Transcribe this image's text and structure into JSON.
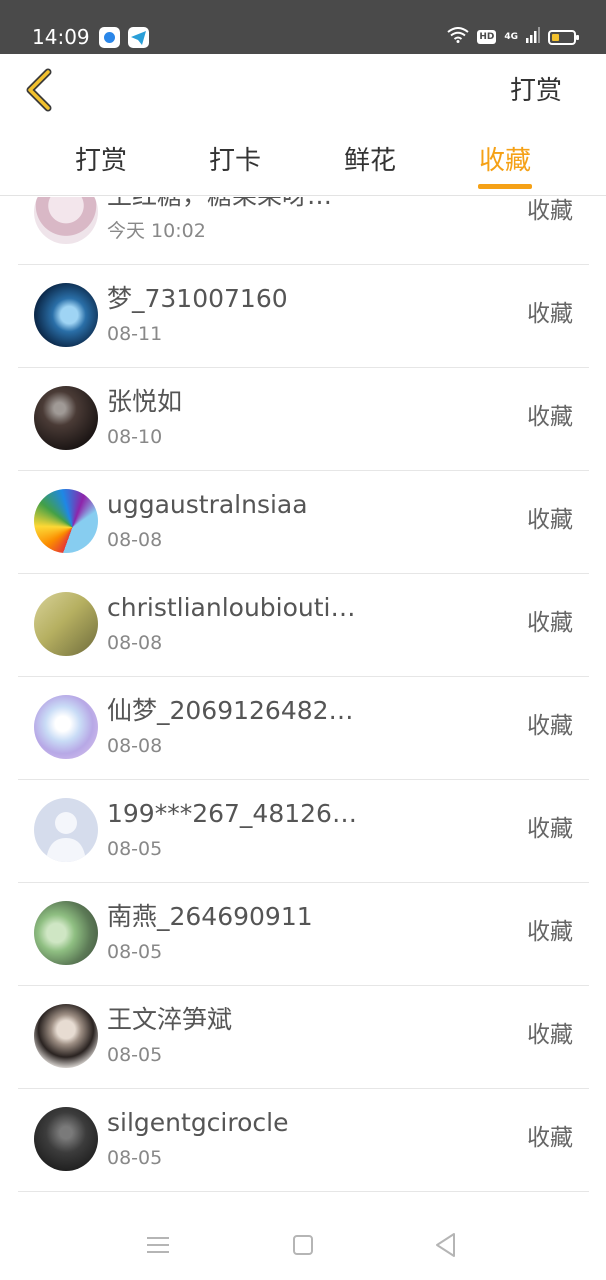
{
  "status_bar": {
    "time": "14:09",
    "hd_label": "HD",
    "network_label": "4G",
    "icons": [
      "app-icon-1",
      "app-icon-2",
      "wifi-icon",
      "signal-icon",
      "battery-icon"
    ]
  },
  "header": {
    "right_action": "打赏"
  },
  "tabs": [
    {
      "label": "打赏",
      "active": false
    },
    {
      "label": "打卡",
      "active": false
    },
    {
      "label": "鲜花",
      "active": false
    },
    {
      "label": "收藏",
      "active": true
    }
  ],
  "accent_color": "#f5a116",
  "list": [
    {
      "name": "王红糖，糖果果呀…",
      "date": "今天 10:02",
      "action": "收藏"
    },
    {
      "name": "梦_731007160",
      "date": "08-11",
      "action": "收藏"
    },
    {
      "name": "张悦如",
      "date": "08-10",
      "action": "收藏"
    },
    {
      "name": "uggaustralnsiaa",
      "date": "08-08",
      "action": "收藏"
    },
    {
      "name": "christlianloubiouti…",
      "date": "08-08",
      "action": "收藏"
    },
    {
      "name": "仙梦_2069126482…",
      "date": "08-08",
      "action": "收藏"
    },
    {
      "name": "199***267_48126…",
      "date": "08-05",
      "action": "收藏"
    },
    {
      "name": "南燕_264690911",
      "date": "08-05",
      "action": "收藏"
    },
    {
      "name": "王文淬笋斌",
      "date": "08-05",
      "action": "收藏"
    },
    {
      "name": "silgentgcirocle",
      "date": "08-05",
      "action": "收藏"
    }
  ],
  "nav_bar": {
    "icons": [
      "menu-icon",
      "home-icon",
      "back-icon"
    ]
  }
}
